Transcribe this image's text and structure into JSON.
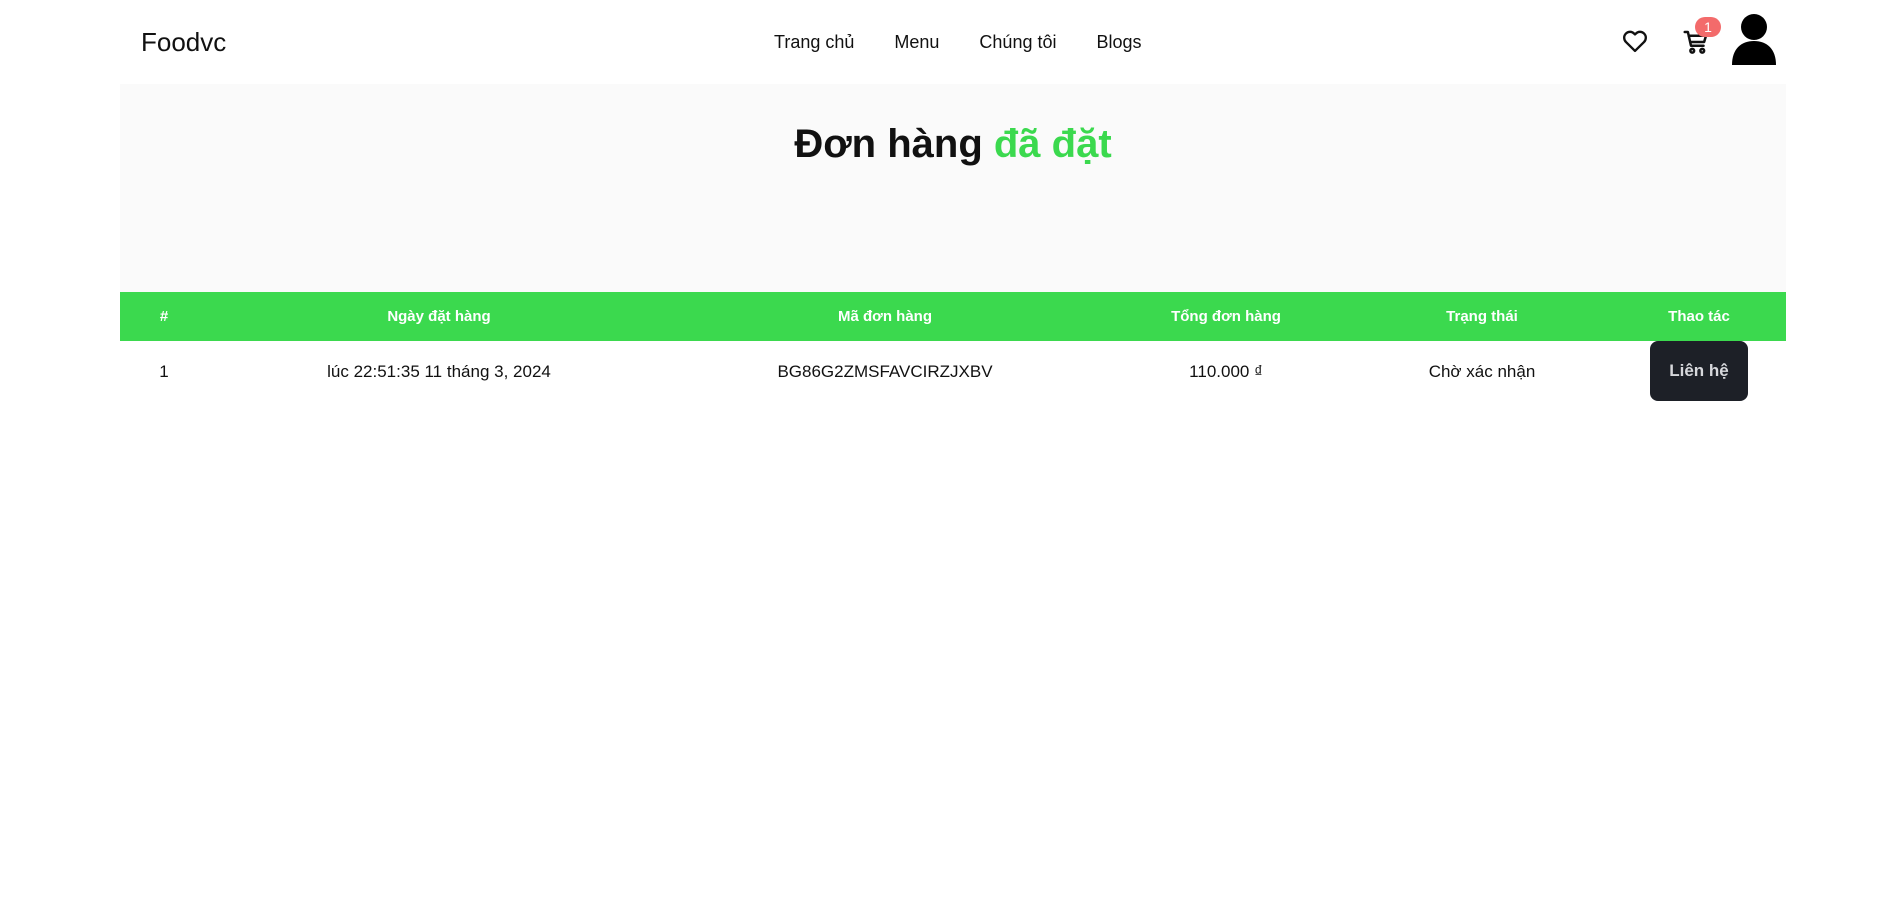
{
  "header": {
    "logo": "Foodvc",
    "nav": [
      "Trang chủ",
      "Menu",
      "Chúng tôi",
      "Blogs"
    ],
    "cart_count": "1",
    "icons": [
      "heart-icon",
      "cart-icon",
      "user-avatar-icon"
    ]
  },
  "hero": {
    "title_main": "Đơn hàng",
    "title_accent": "đã đặt"
  },
  "table": {
    "headers": [
      "#",
      "Ngày đặt hàng",
      "Mã đơn hàng",
      "Tổng đơn hàng",
      "Trạng thái",
      "Thao tác"
    ],
    "rows": [
      {
        "index": "1",
        "date": "lúc 22:51:35 11 tháng 3, 2024",
        "code": "BG86G2ZMSFAVCIRZJXBV",
        "total": "110.000 ₫",
        "status": "Chờ xác nhận",
        "action": "Liên hệ"
      }
    ]
  },
  "colors": {
    "accent": "#3bd94e",
    "badge": "#f36b6b",
    "button_dark": "#1d2027"
  }
}
